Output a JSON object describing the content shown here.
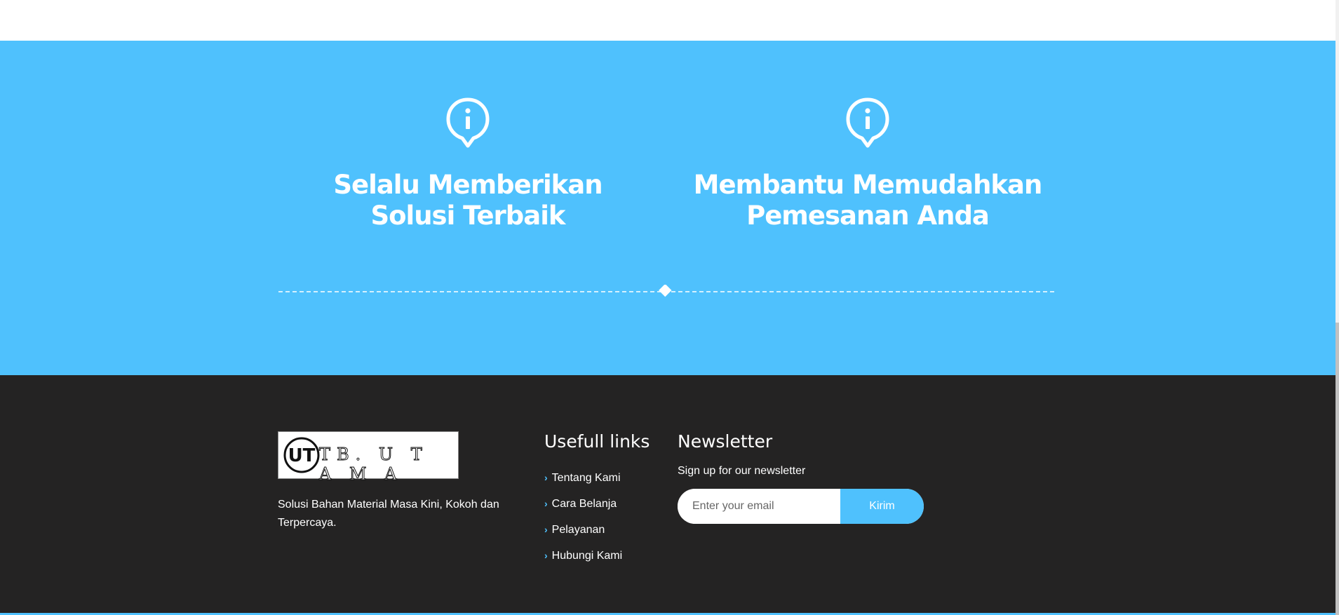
{
  "features": [
    {
      "icon": "info-pin-icon",
      "title_line1": "Selalu Memberikan",
      "title_line2": "Solusi Terbaik"
    },
    {
      "icon": "info-pin-icon",
      "title_line1": "Membantu Memudahkan",
      "title_line2": "Pemesanan Anda"
    }
  ],
  "colors": {
    "accent": "#4fc1fd",
    "footer_bg": "#242323",
    "text_light": "#ffffff"
  },
  "footer": {
    "logo": {
      "monogram": "UT",
      "text": "TB. U T A M A"
    },
    "tagline": "Solusi Bahan Material Masa Kini, Kokoh dan Terpercaya.",
    "links_title": "Usefull links",
    "links": [
      "Tentang Kami",
      "Cara Belanja",
      "Pelayanan",
      "Hubungi Kami"
    ],
    "newsletter": {
      "title": "Newsletter",
      "description": "Sign up for our newsletter",
      "placeholder": "Enter your email",
      "button_label": "Kirim"
    }
  }
}
